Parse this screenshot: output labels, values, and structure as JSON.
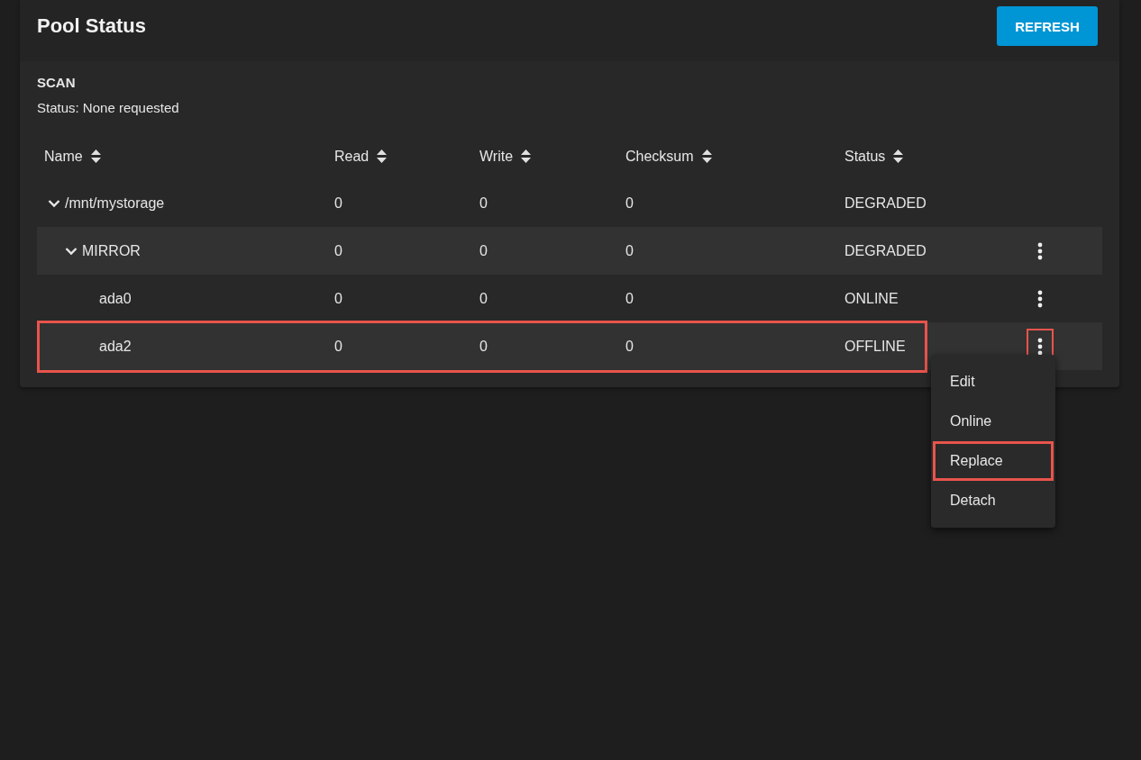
{
  "card": {
    "title": "Pool Status",
    "refresh_button": "REFRESH"
  },
  "scan": {
    "heading": "SCAN",
    "status": "Status: None requested"
  },
  "table": {
    "columns": [
      "Name",
      "Read",
      "Write",
      "Checksum",
      "Status"
    ],
    "rows": [
      {
        "name": "/mnt/mystorage",
        "read": "0",
        "write": "0",
        "checksum": "0",
        "status": "DEGRADED",
        "expanded": true,
        "menu_button": false,
        "highlighted": false,
        "children": [
          {
            "name": "MIRROR",
            "read": "0",
            "write": "0",
            "checksum": "0",
            "status": "DEGRADED",
            "expanded": true,
            "menu_button": true,
            "highlighted": false,
            "children": [
              {
                "name": "ada0",
                "read": "0",
                "write": "0",
                "checksum": "0",
                "status": "ONLINE",
                "menu_button": true,
                "highlighted": false
              },
              {
                "name": "ada2",
                "read": "0",
                "write": "0",
                "checksum": "0",
                "status": "OFFLINE",
                "menu_button": true,
                "highlighted": true,
                "menu_button_highlighted": true,
                "menu": [
                  {
                    "label": "Edit",
                    "highlighted": false
                  },
                  {
                    "label": "Online",
                    "highlighted": false
                  },
                  {
                    "label": "Replace",
                    "highlighted": true
                  },
                  {
                    "label": "Detach",
                    "highlighted": false
                  }
                ]
              }
            ]
          }
        ]
      }
    ]
  }
}
